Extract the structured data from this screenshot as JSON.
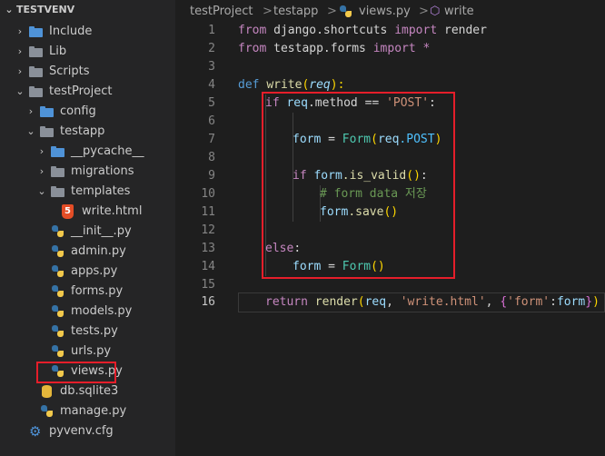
{
  "explorer": {
    "root": "TESTVENV",
    "items": [
      {
        "label": "Include",
        "kind": "folder",
        "depth": 0,
        "chevron": "right"
      },
      {
        "label": "Lib",
        "kind": "folder",
        "depth": 0,
        "chevron": "right"
      },
      {
        "label": "Scripts",
        "kind": "folder",
        "depth": 0,
        "chevron": "right"
      },
      {
        "label": "testProject",
        "kind": "folder",
        "depth": 0,
        "chevron": "down"
      },
      {
        "label": "config",
        "kind": "folder",
        "depth": 1,
        "chevron": "right"
      },
      {
        "label": "testapp",
        "kind": "folder",
        "depth": 1,
        "chevron": "down"
      },
      {
        "label": "__pycache__",
        "kind": "folder",
        "depth": 2,
        "chevron": "right"
      },
      {
        "label": "migrations",
        "kind": "folder",
        "depth": 2,
        "chevron": "right"
      },
      {
        "label": "templates",
        "kind": "folder",
        "depth": 2,
        "chevron": "down"
      },
      {
        "label": "write.html",
        "kind": "html",
        "depth": 3
      },
      {
        "label": "__init__.py",
        "kind": "py",
        "depth": 2
      },
      {
        "label": "admin.py",
        "kind": "py",
        "depth": 2
      },
      {
        "label": "apps.py",
        "kind": "py",
        "depth": 2
      },
      {
        "label": "forms.py",
        "kind": "py",
        "depth": 2
      },
      {
        "label": "models.py",
        "kind": "py",
        "depth": 2
      },
      {
        "label": "tests.py",
        "kind": "py",
        "depth": 2
      },
      {
        "label": "urls.py",
        "kind": "py",
        "depth": 2
      },
      {
        "label": "views.py",
        "kind": "py",
        "depth": 2
      },
      {
        "label": "db.sqlite3",
        "kind": "db",
        "depth": 1
      },
      {
        "label": "manage.py",
        "kind": "py",
        "depth": 1
      },
      {
        "label": "pyvenv.cfg",
        "kind": "cfg",
        "depth": 0
      }
    ]
  },
  "breadcrumb": {
    "folder1": "testProject",
    "folder2": "testapp",
    "file": "views.py",
    "symbol": "write",
    "separator": ">"
  },
  "editor": {
    "line_numbers": [
      "1",
      "2",
      "3",
      "4",
      "5",
      "6",
      "7",
      "8",
      "9",
      "10",
      "11",
      "12",
      "13",
      "14",
      "15",
      "16"
    ],
    "active_line": "16",
    "tokens": {
      "l1": [
        "from",
        "django.shortcuts",
        "import",
        "render"
      ],
      "l2": [
        "from",
        "testapp.forms",
        "import",
        "*"
      ],
      "l4": [
        "def",
        "write",
        "(",
        "req",
        "):"
      ],
      "l5": [
        "if",
        "req",
        ".method ",
        "==",
        "'POST'",
        ":"
      ],
      "l7": [
        "form",
        "=",
        "Form",
        "(",
        "req",
        ".POST",
        ")"
      ],
      "l9": [
        "if",
        "form",
        ".is_valid",
        "()",
        ":"
      ],
      "l10": [
        "# form data 저장"
      ],
      "l11": [
        "form",
        ".save",
        "()"
      ],
      "l13": [
        "else",
        ":"
      ],
      "l14": [
        "form",
        "=",
        "Form",
        "()"
      ],
      "l16": [
        "return",
        "render",
        "(",
        "req",
        ", ",
        "'write.html'",
        ", ",
        "{",
        "'form'",
        ":",
        "form",
        "}",
        ")"
      ]
    }
  },
  "colors": {
    "highlight_box": "#e51e2a",
    "keyword": "#c586c0",
    "def_keyword": "#569cd6",
    "function": "#dcdcaa",
    "string": "#ce9178",
    "variable": "#9cdcfe",
    "class": "#4ec9b0",
    "comment": "#6a9955"
  }
}
